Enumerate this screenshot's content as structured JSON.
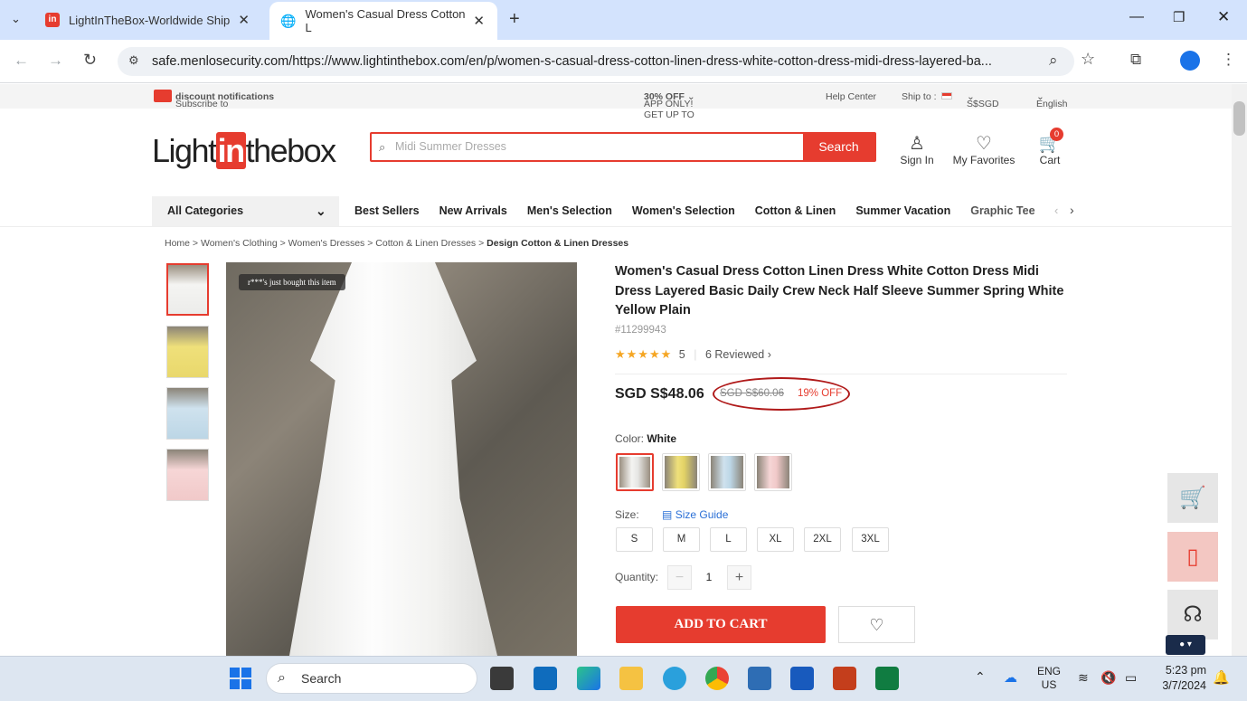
{
  "browser": {
    "tabs": [
      {
        "title": "LightInTheBox-Worldwide Ship"
      },
      {
        "title": "Women's Casual Dress Cotton L"
      }
    ],
    "new_tab": "+",
    "url": "safe.menlosecurity.com/https://www.lightinthebox.com/en/p/women-s-casual-dress-cotton-linen-dress-white-cotton-dress-midi-dress-layered-ba..."
  },
  "topstrip": {
    "subscribe_pre": "Subscribe to",
    "subscribe_bold": "discount notifications",
    "app_only": "APP ONLY! GET UP TO",
    "app_off": "30% OFF",
    "help": "Help Center",
    "ship_to": "Ship to :",
    "currency": "S$SGD",
    "language": "English"
  },
  "header": {
    "logo_light": "Light",
    "logo_in": "in",
    "logo_box": "thebox",
    "search_placeholder": "Midi Summer Dresses",
    "search_button": "Search",
    "sign_in": "Sign In",
    "favorites": "My Favorites",
    "cart": "Cart",
    "cart_count": "0"
  },
  "nav": {
    "all_categories": "All Categories",
    "items": [
      "Best Sellers",
      "New Arrivals",
      "Men's Selection",
      "Women's Selection",
      "Cotton & Linen",
      "Summer Vacation",
      "Graphic Tee"
    ]
  },
  "breadcrumb": [
    "Home",
    "Women's Clothing",
    "Women's Dresses",
    "Cotton & Linen Dresses",
    "Design Cotton & Linen Dresses"
  ],
  "product": {
    "bought_toast": "r***'s just bought this item",
    "title": "Women's Casual Dress Cotton Linen Dress White Cotton Dress Midi Dress Layered Basic Daily Crew Neck Half Sleeve Summer Spring White Yellow Plain",
    "sku": "#11299943",
    "rating_value": "5",
    "reviews": "6 Reviewed",
    "price": "SGD S$48.06",
    "old_price": "SGD S$60.06",
    "discount": "19% OFF",
    "color_label": "Color:",
    "color_value": "White",
    "size_label": "Size:",
    "size_guide": "Size Guide",
    "sizes": [
      "S",
      "M",
      "L",
      "XL",
      "2XL",
      "3XL"
    ],
    "quantity_label": "Quantity:",
    "quantity": "1",
    "add_to_cart": "ADD TO CART",
    "swatch_colors": [
      "#f2f2f2",
      "#efe07a",
      "#bcd6e6",
      "#f1c9c9"
    ]
  },
  "taskbar": {
    "search": "Search",
    "lang_top": "ENG",
    "lang_bottom": "US",
    "time": "5:23 pm",
    "date": "3/7/2024"
  }
}
